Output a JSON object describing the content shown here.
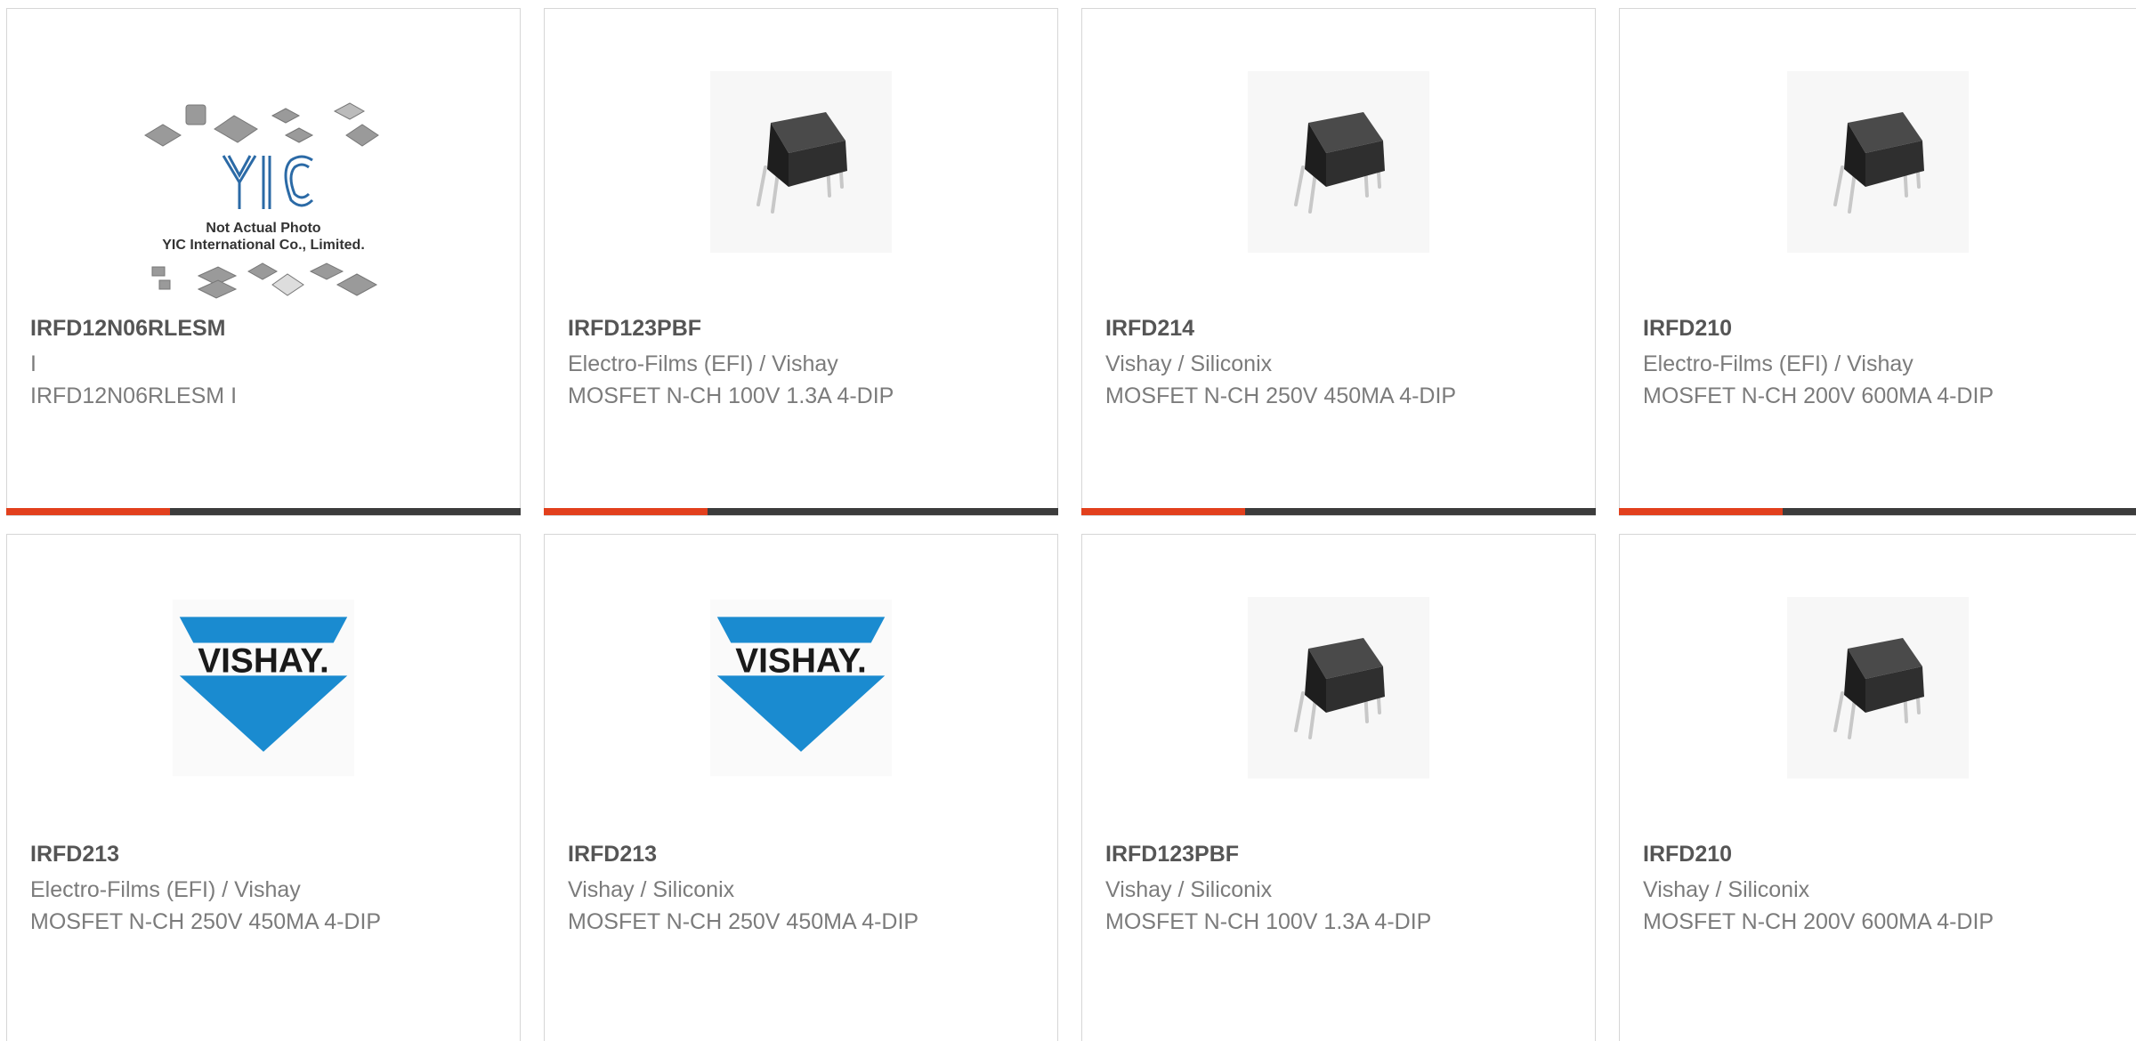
{
  "colors": {
    "accent": "#e2401d",
    "bar": "#3c3c3c",
    "title": "#555555",
    "text": "#7b7b7b"
  },
  "products": [
    {
      "part": "IRFD12N06RLESM",
      "maker": "I",
      "desc": "IRFD12N06RLESM I",
      "image": "not-actual-photo",
      "placeholder": {
        "logo": "YIC",
        "line1": "Not Actual Photo",
        "line2": "YIC International Co., Limited."
      }
    },
    {
      "part": "IRFD123PBF",
      "maker": "Electro-Films (EFI) / Vishay",
      "desc": "MOSFET N-CH 100V 1.3A 4-DIP",
      "image": "dip-package"
    },
    {
      "part": "IRFD214",
      "maker": "Vishay / Siliconix",
      "desc": "MOSFET N-CH 250V 450MA 4-DIP",
      "image": "dip-package"
    },
    {
      "part": "IRFD210",
      "maker": "Electro-Films (EFI) / Vishay",
      "desc": "MOSFET N-CH 200V 600MA 4-DIP",
      "image": "dip-package"
    },
    {
      "part": "IRFD213",
      "maker": "Electro-Films (EFI) / Vishay",
      "desc": "MOSFET N-CH 250V 450MA 4-DIP",
      "image": "vishay-logo",
      "logo_text": "VISHAY."
    },
    {
      "part": "IRFD213",
      "maker": "Vishay / Siliconix",
      "desc": "MOSFET N-CH 250V 450MA 4-DIP",
      "image": "vishay-logo",
      "logo_text": "VISHAY."
    },
    {
      "part": "IRFD123PBF",
      "maker": "Vishay / Siliconix",
      "desc": "MOSFET N-CH 100V 1.3A 4-DIP",
      "image": "dip-package"
    },
    {
      "part": "IRFD210",
      "maker": "Vishay / Siliconix",
      "desc": "MOSFET N-CH 200V 600MA 4-DIP",
      "image": "dip-package"
    }
  ]
}
